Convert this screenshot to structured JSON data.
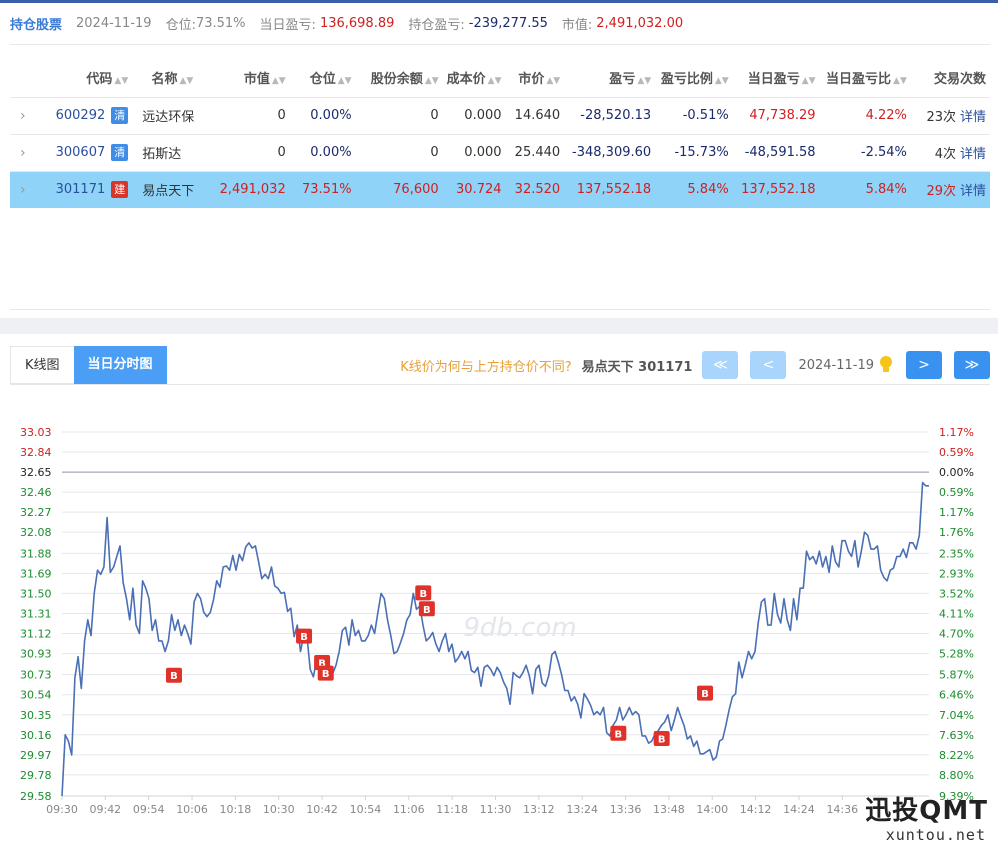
{
  "summary": {
    "title": "持仓股票",
    "date": "2024-11-19",
    "position_label": "仓位:",
    "position_value": "73.51%",
    "day_pnl_label": "当日盈亏:",
    "day_pnl_value": "136,698.89",
    "hold_pnl_label": "持仓盈亏:",
    "hold_pnl_value": "-239,277.55",
    "market_value_label": "市值:",
    "market_value_value": "2,491,032.00"
  },
  "table": {
    "headers": [
      "代码",
      "名称",
      "市值",
      "仓位",
      "股份余额",
      "成本价",
      "市价",
      "盈亏",
      "盈亏比例",
      "当日盈亏",
      "当日盈亏比",
      "交易次数"
    ],
    "detail_label": "详情",
    "rows": [
      {
        "code": "600292",
        "tag": "清",
        "name": "远达环保",
        "market_value": "0",
        "position": "0.00%",
        "shares": "0",
        "cost": "0.000",
        "price": "14.640",
        "pnl": "-28,520.13",
        "pnl_pct": "-0.51%",
        "day_pnl": "47,738.29",
        "day_pnl_pct": "4.22%",
        "trades": "23次"
      },
      {
        "code": "300607",
        "tag": "清",
        "name": "拓斯达",
        "market_value": "0",
        "position": "0.00%",
        "shares": "0",
        "cost": "0.000",
        "price": "25.440",
        "pnl": "-348,309.60",
        "pnl_pct": "-15.73%",
        "day_pnl": "-48,591.58",
        "day_pnl_pct": "-2.54%",
        "trades": "4次"
      },
      {
        "code": "301171",
        "tag": "建",
        "name": "易点天下",
        "market_value": "2,491,032",
        "position": "73.51%",
        "shares": "76,600",
        "cost": "30.724",
        "price": "32.520",
        "pnl": "137,552.18",
        "pnl_pct": "5.84%",
        "day_pnl": "137,552.18",
        "day_pnl_pct": "5.84%",
        "trades": "29次"
      }
    ]
  },
  "tabs": {
    "kline": "K线图",
    "intraday": "当日分时图"
  },
  "nav": {
    "question": "K线价为何与上方持仓价不同?",
    "stock": "易点天下 301171",
    "date": "2024-11-19",
    "first": "≪",
    "prev": "<",
    "next": ">",
    "last": "≫"
  },
  "watermark": {
    "brand": "迅投QMT",
    "url": "xuntou.net",
    "faint": "9db.com"
  },
  "colors": {
    "line": "#4a6fb5",
    "up": "#d01f1f",
    "down": "#1c8c2e",
    "marker": "#e0312b",
    "highlight": "#8fd3f8",
    "accent": "#4a9ef5"
  },
  "chart_data": {
    "type": "line",
    "prev_close": 32.65,
    "ylim": [
      29.58,
      33.03
    ],
    "y_ticks": [
      "33.03",
      "32.84",
      "32.65",
      "32.46",
      "32.27",
      "32.08",
      "31.88",
      "31.69",
      "31.50",
      "31.31",
      "31.12",
      "30.93",
      "30.73",
      "30.54",
      "30.35",
      "30.16",
      "29.97",
      "29.78",
      "29.58"
    ],
    "pct_ticks": [
      "1.17%",
      "0.59%",
      "0.00%",
      "0.59%",
      "1.17%",
      "1.76%",
      "2.35%",
      "2.93%",
      "3.52%",
      "4.11%",
      "4.70%",
      "5.28%",
      "5.87%",
      "6.46%",
      "7.04%",
      "7.63%",
      "8.22%",
      "8.80%",
      "9.39%"
    ],
    "x_ticks": [
      "09:30",
      "09:42",
      "09:54",
      "10:06",
      "10:18",
      "10:30",
      "10:42",
      "10:54",
      "11:06",
      "11:18",
      "11:30",
      "13:12",
      "13:24",
      "13:36",
      "13:48",
      "14:00",
      "14:12",
      "14:24",
      "14:36"
    ],
    "series": [
      {
        "values": [
          29.58,
          30.16,
          30.1,
          29.97,
          30.7,
          30.9,
          30.6,
          31.05,
          31.25,
          31.1,
          31.5,
          31.72,
          31.68,
          31.75,
          32.22,
          31.7,
          31.75,
          31.85,
          31.95,
          31.6,
          31.45,
          31.25,
          31.55,
          31.2,
          31.12,
          31.62,
          31.55,
          31.45,
          31.15,
          31.25,
          31.05,
          31.05,
          30.95,
          31.05,
          31.3,
          31.15,
          31.25,
          31.1,
          31.2,
          31.12,
          31.02,
          31.42,
          31.5,
          31.45,
          31.32,
          31.28,
          31.32,
          31.44,
          31.62,
          31.56,
          31.75,
          31.76,
          31.72,
          31.86,
          31.72,
          31.87,
          31.81,
          31.94,
          31.98,
          31.93,
          31.95,
          31.8,
          31.64,
          31.68,
          31.64,
          31.75,
          31.57,
          31.55,
          31.5,
          31.51,
          31.33,
          31.36,
          31.09,
          31.2,
          30.95,
          31.1,
          31.09,
          30.78,
          30.71,
          30.87,
          30.9,
          30.84,
          30.71,
          30.81,
          30.74,
          30.82,
          30.95,
          31.15,
          31.18,
          31.01,
          31.25,
          31.1,
          31.15,
          31.05,
          31.05,
          31.1,
          31.2,
          31.12,
          31.32,
          31.5,
          31.45,
          31.25,
          31.1,
          30.93,
          30.95,
          31.03,
          31.12,
          31.25,
          31.3,
          31.5,
          31.35,
          31.38,
          31.2,
          31.05,
          31.08,
          31.13,
          31.02,
          30.95,
          31.05,
          31.12,
          30.95,
          31.02,
          30.85,
          30.89,
          30.95,
          30.88,
          30.95,
          30.77,
          30.75,
          30.8,
          30.62,
          30.8,
          30.82,
          30.78,
          30.72,
          30.8,
          30.75,
          30.66,
          30.6,
          30.45,
          30.75,
          30.72,
          30.7,
          30.75,
          30.82,
          30.72,
          30.55,
          30.78,
          30.82,
          30.65,
          30.62,
          30.72,
          30.92,
          30.95,
          30.85,
          30.73,
          30.58,
          30.58,
          30.48,
          30.52,
          30.45,
          30.32,
          30.55,
          30.5,
          30.44,
          30.35,
          30.38,
          30.35,
          30.42,
          30.18,
          30.15,
          30.25,
          30.3,
          30.42,
          30.3,
          30.35,
          30.42,
          30.35,
          30.38,
          30.35,
          30.15,
          30.15,
          30.08,
          30.1,
          30.17,
          30.2,
          30.25,
          30.28,
          30.35,
          30.2,
          30.3,
          30.42,
          30.33,
          30.25,
          30.12,
          30.15,
          30.05,
          30.1,
          29.98,
          29.98,
          30.0,
          30.02,
          29.92,
          29.95,
          30.1,
          30.12,
          30.25,
          30.4,
          30.52,
          30.55,
          30.85,
          30.7,
          30.82,
          30.95,
          30.88,
          30.95,
          31.22,
          31.42,
          31.45,
          31.2,
          31.2,
          31.5,
          31.3,
          31.22,
          31.45,
          31.25,
          31.15,
          31.45,
          31.25,
          31.55,
          31.55,
          31.9,
          31.82,
          31.85,
          31.78,
          31.9,
          31.75,
          31.85,
          31.7,
          31.95,
          31.8,
          31.75,
          32.0,
          32.0,
          31.9,
          31.85,
          32.0,
          31.75,
          31.9,
          32.08,
          32.05,
          31.92,
          31.92,
          31.95,
          31.72,
          31.65,
          31.62,
          31.72,
          31.74,
          31.85,
          31.85,
          31.92,
          31.84,
          31.98,
          31.98,
          31.92,
          32.05,
          32.55,
          32.52,
          32.52
        ]
      }
    ],
    "buy_markers": [
      {
        "time": "10:37",
        "price": 31.09
      },
      {
        "time": "10:42",
        "price": 30.84
      },
      {
        "time": "10:43",
        "price": 30.74
      },
      {
        "time": "11:10",
        "price": 31.5
      },
      {
        "time": "11:11",
        "price": 31.35
      },
      {
        "time": "11:31",
        "price": 30.72
      },
      {
        "time": "13:34",
        "price": 30.17
      },
      {
        "time": "13:46",
        "price": 30.12
      },
      {
        "time": "13:58",
        "price": 30.55
      }
    ],
    "marker_label": "B"
  }
}
